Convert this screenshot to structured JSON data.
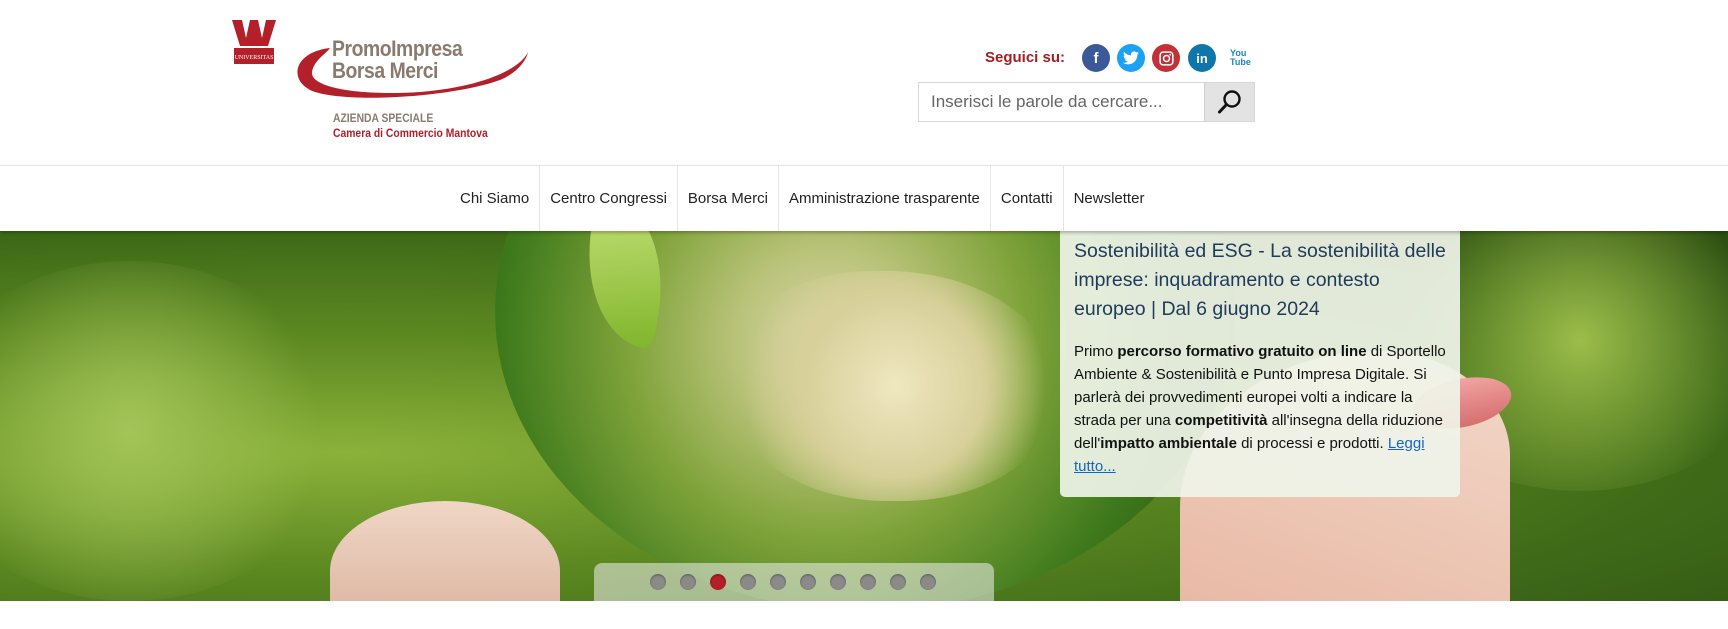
{
  "brand": {
    "name_line1": "PromoImpresa",
    "name_line2": "Borsa Merci",
    "subtitle_line1": "AZIENDA SPECIALE",
    "subtitle_line2": "Camera di Commercio Mantova",
    "crest_text": "UNIVERSITAS",
    "colors": {
      "red": "#b3202a",
      "taupe": "#8a7b6e"
    }
  },
  "social": {
    "label": "Seguici su:",
    "items": [
      {
        "name": "facebook",
        "glyph": "f",
        "color": "#3b5998"
      },
      {
        "name": "twitter",
        "glyph": "t",
        "color": "#1da1f2"
      },
      {
        "name": "instagram",
        "glyph": "◎",
        "color": "#c13238"
      },
      {
        "name": "linkedin",
        "glyph": "in",
        "color": "#0e76a8"
      },
      {
        "name": "youtube",
        "glyph": "You Tube",
        "color": "#1b86c9"
      }
    ]
  },
  "search": {
    "placeholder": "Inserisci le parole da cercare...",
    "value": ""
  },
  "nav": {
    "items": [
      "Chi Siamo",
      "Centro Congressi",
      "Borsa Merci",
      "Amministrazione trasparente",
      "Contatti",
      "Newsletter"
    ]
  },
  "slide": {
    "title": "Sostenibilità ed ESG - La sostenibilità delle imprese: inquadramento e contesto europeo | Dal 6 giugno 2024",
    "body": {
      "t1": "Primo ",
      "b1": "percorso formativo gratuito on line",
      "t2": " di Sportello Ambiente & Sostenibilità e Punto Impresa Digitale. Si parlerà dei provvedimenti europei volti a indicare la strada per una ",
      "b2": "competitività",
      "t3": " all'insegna della riduzione dell'",
      "b3": "impatto ambientale",
      "t4": " di processi e prodotti. ",
      "link": "Leggi tutto..."
    }
  },
  "carousel": {
    "total": 10,
    "active_index": 2,
    "active_color": "#b3202a"
  }
}
